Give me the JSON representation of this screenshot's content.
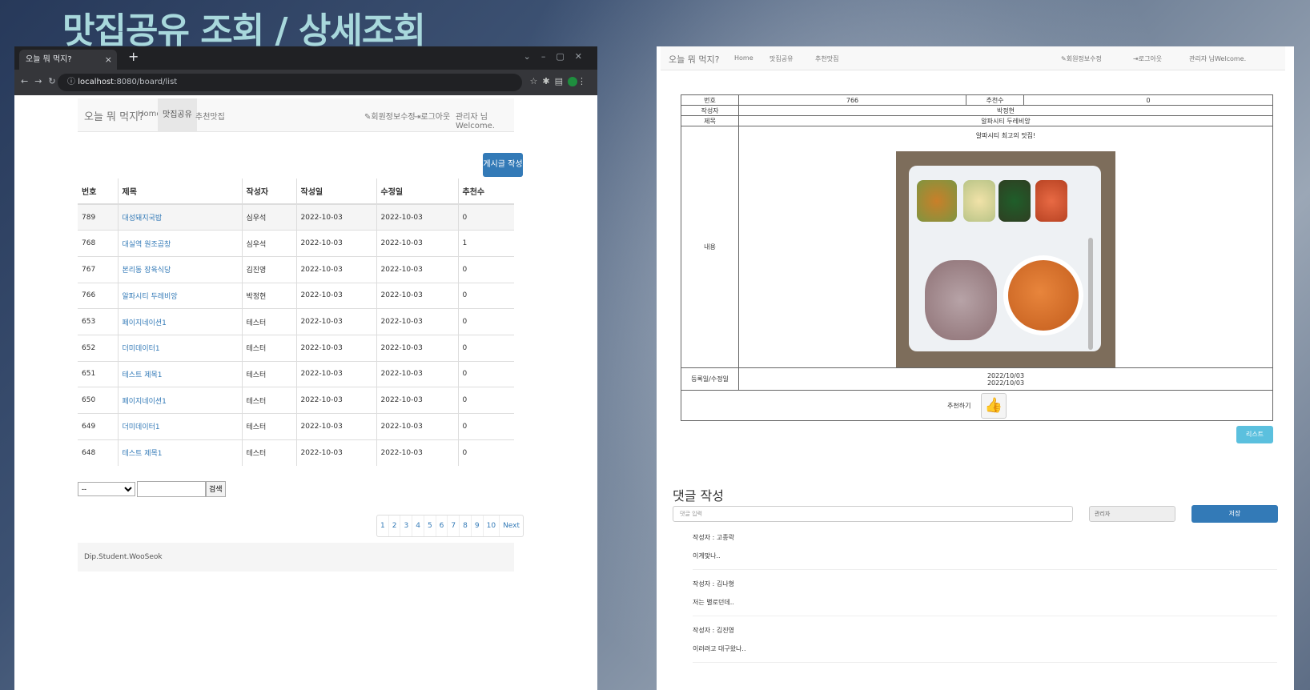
{
  "slide": {
    "title": "맛집공유 조회 / 상세조회"
  },
  "browser": {
    "tab_title": "오늘 뭐 먹지?",
    "tab_close": "×",
    "new_tab": "+",
    "url_host": "localhost",
    "url_path": ":8080/board/list"
  },
  "site": {
    "brand": "오늘 뭐 먹지?",
    "nav": [
      "Home",
      "맛집공유",
      "추천맛집"
    ],
    "nav_right": [
      "회원정보수정",
      "로그아웃",
      "관리자 님Welcome."
    ]
  },
  "board": {
    "write_button": "게시글 작성",
    "headers": [
      "번호",
      "제목",
      "작성자",
      "작성일",
      "수정일",
      "추천수"
    ],
    "rows": [
      [
        "789",
        "대성돼지국밥",
        "심우석",
        "2022-10-03",
        "2022-10-03",
        "0"
      ],
      [
        "768",
        "대실역 원조곱창",
        "심우석",
        "2022-10-03",
        "2022-10-03",
        "1"
      ],
      [
        "767",
        "본리동 장육식당",
        "김진영",
        "2022-10-03",
        "2022-10-03",
        "0"
      ],
      [
        "766",
        "알파시티 두레비앙",
        "박정현",
        "2022-10-03",
        "2022-10-03",
        "0"
      ],
      [
        "653",
        "페이지네이션1",
        "테스터",
        "2022-10-03",
        "2022-10-03",
        "0"
      ],
      [
        "652",
        "더미데이터1",
        "테스터",
        "2022-10-03",
        "2022-10-03",
        "0"
      ],
      [
        "651",
        "테스트 제목1",
        "테스터",
        "2022-10-03",
        "2022-10-03",
        "0"
      ],
      [
        "650",
        "페이지네이션1",
        "테스터",
        "2022-10-03",
        "2022-10-03",
        "0"
      ],
      [
        "649",
        "더미데이터1",
        "테스터",
        "2022-10-03",
        "2022-10-03",
        "0"
      ],
      [
        "648",
        "테스트 제목1",
        "테스터",
        "2022-10-03",
        "2022-10-03",
        "0"
      ]
    ],
    "search_select": "--",
    "search_button": "검색",
    "pages": [
      "1",
      "2",
      "3",
      "4",
      "5",
      "6",
      "7",
      "8",
      "9",
      "10",
      "Next"
    ],
    "footer": "Dip.Student.WooSeok"
  },
  "detail": {
    "brand": "오늘 뭐 먹지?",
    "nav": [
      "Home",
      "맛집공유",
      "추천맛집"
    ],
    "nav_right": [
      "회원정보수정",
      "로그아웃",
      "관리자 님Welcome."
    ],
    "labels": {
      "number": "번호",
      "likes": "추천수",
      "writer": "작성자",
      "title": "제목",
      "content": "내용",
      "dates": "등록일/수정일",
      "recommend": "추천하기"
    },
    "number": "766",
    "likes": "0",
    "writer": "박정현",
    "title": "알파시티 두레비앙",
    "content_text": "알파시티 최고의 맛집!",
    "reg_date": "2022/10/03",
    "mod_date": "2022/10/03",
    "list_button": "리스트",
    "comment_title": "댓글 작성",
    "comment_placeholder": "댓글 입력",
    "comment_writer": "관리자",
    "save_button": "저장",
    "comments": [
      {
        "writer": "작성자 : 고종락",
        "text": "이게맞나.."
      },
      {
        "writer": "작성자 : 김나형",
        "text": "저는 별로던데.."
      },
      {
        "writer": "작성자 : 김진영",
        "text": "이러려고 대구왔나.."
      }
    ]
  },
  "colors": {
    "primary": "#337ab7",
    "info": "#5bc0de",
    "title": "#a8d8dc"
  }
}
